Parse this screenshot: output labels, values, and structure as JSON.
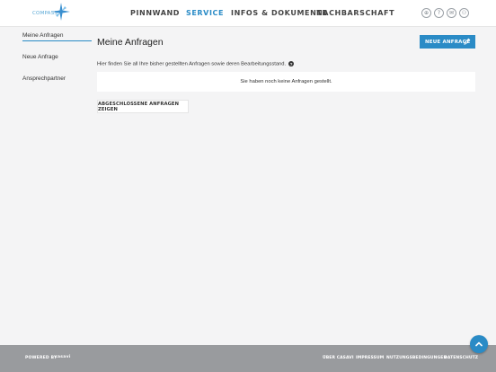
{
  "header": {
    "logo_text": "COMPASS",
    "nav": [
      "PINNWAND",
      "SERVICE",
      "INFOS & DOKUMENTE",
      "NACHBARSCHAFT"
    ],
    "active_nav": "SERVICE",
    "icons": [
      {
        "name": "globe-icon",
        "glyph": "⊕"
      },
      {
        "name": "help-icon",
        "glyph": "?"
      },
      {
        "name": "mail-icon",
        "glyph": "✉"
      },
      {
        "name": "user-icon",
        "glyph": "⚇"
      }
    ]
  },
  "sidebar": {
    "items": [
      "Meine Anfragen",
      "Neue Anfrage",
      "Ansprechpartner"
    ]
  },
  "main": {
    "title": "Meine Anfragen",
    "new_button": "NEUE ANFRAGE",
    "description": "Hier finden Sie all Ihre bisher gestellten Anfragen sowie deren Bearbeitungsstand.",
    "help_glyph": "?",
    "empty_message": "Sie haben noch keine Anfragen gestellt.",
    "closed_button": "ABGESCHLOSSENE ANFRAGEN ZEIGEN"
  },
  "footer": {
    "powered_by": "POWERED BY",
    "brand": "casavi",
    "links": [
      "ÜBER CASAVI",
      "IMPRESSUM",
      "NUTZUNGSBEDINGUNGEN",
      "DATENSCHUTZ"
    ]
  },
  "colors": {
    "accent": "#2a8bc6",
    "footer": "#999b9e",
    "background": "#f4f4f5"
  }
}
